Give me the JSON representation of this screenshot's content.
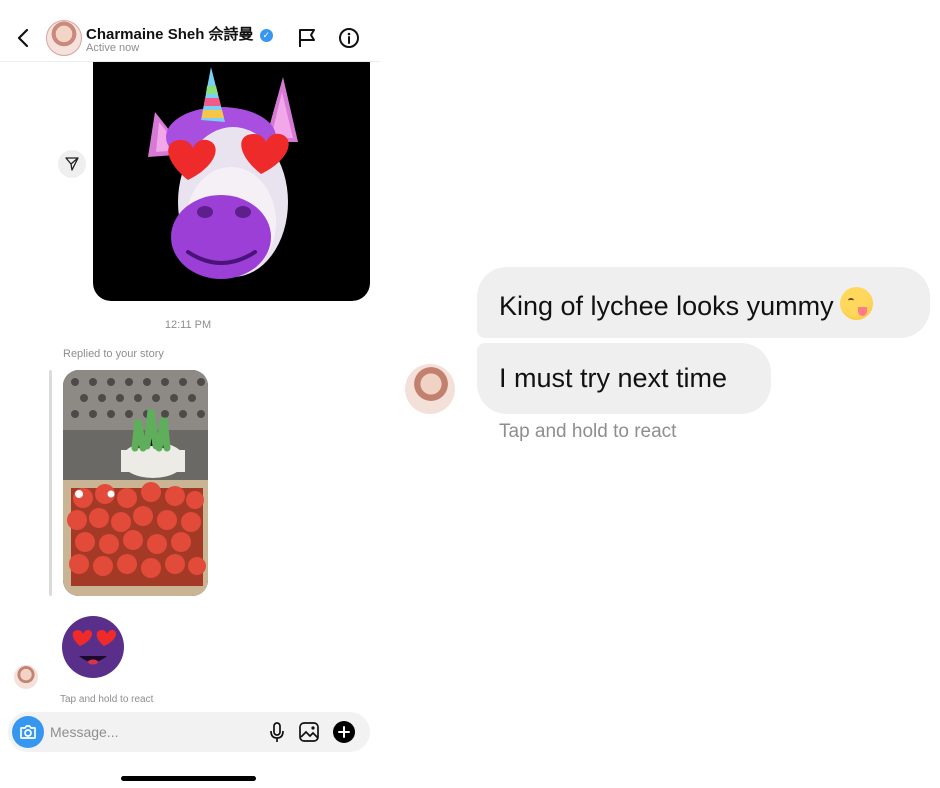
{
  "header": {
    "contact_name": "Charmaine Sheh 佘詩曼",
    "verified_badge": "✓",
    "status": "Active now"
  },
  "thread": {
    "timestamp": "12:11 PM",
    "story_reply_label": "Replied to your story",
    "reaction_hint": "Tap and hold to react"
  },
  "composer": {
    "placeholder": "Message..."
  },
  "zoom": {
    "message_1": "King of lychee looks yummy",
    "message_2": "I must try next time",
    "reaction_hint": "Tap and hold to react"
  },
  "colors": {
    "accent": "#3797f0",
    "bubble": "#efefef",
    "muted_text": "#8e8e8e"
  },
  "icons": {
    "back": "chevron-left-icon",
    "flag": "flag-icon",
    "info": "info-icon",
    "share": "send-icon",
    "camera": "camera-icon",
    "mic": "microphone-icon",
    "gallery": "image-icon",
    "plus": "plus-icon"
  }
}
